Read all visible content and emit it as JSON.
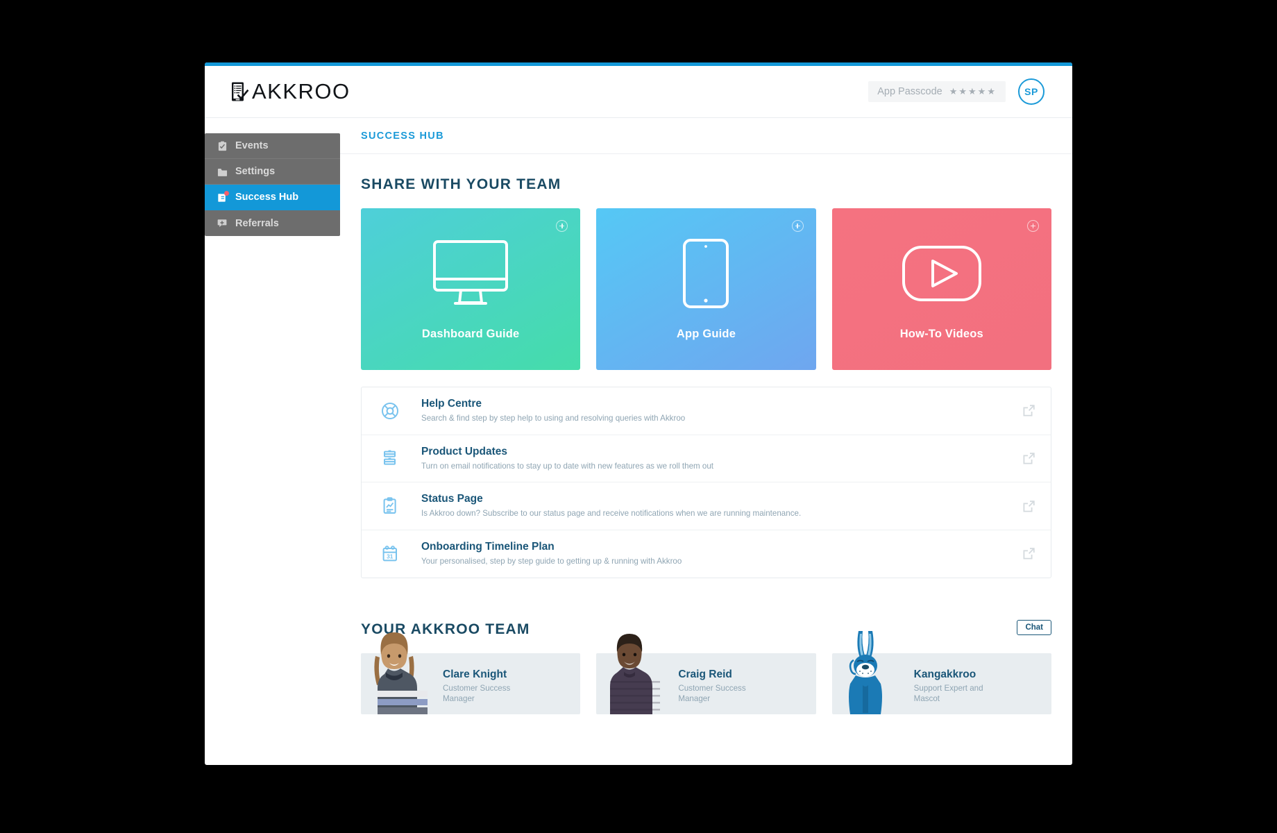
{
  "brand": {
    "name": "AKKROO",
    "logo_icon": "clipboard-check-icon"
  },
  "header": {
    "passcode_label": "App Passcode",
    "passcode_value": "★★★★★",
    "avatar_initials": "SP"
  },
  "sidebar": {
    "items": [
      {
        "label": "Events",
        "icon": "clipboard-icon",
        "active": false,
        "badge": false
      },
      {
        "label": "Settings",
        "icon": "folder-icon",
        "active": false,
        "badge": false
      },
      {
        "label": "Success Hub",
        "icon": "book-badge-icon",
        "active": true,
        "badge": true
      },
      {
        "label": "Referrals",
        "icon": "flag-plus-icon",
        "active": false,
        "badge": false
      }
    ]
  },
  "breadcrumb": {
    "label": "SUCCESS HUB"
  },
  "share_section": {
    "title": "SHARE WITH YOUR TEAM",
    "cards": [
      {
        "label": "Dashboard Guide",
        "art": "desktop-monitor-icon",
        "theme": "teal",
        "action_icon": "plus-circle-icon"
      },
      {
        "label": "App Guide",
        "art": "tablet-icon",
        "theme": "blue",
        "action_icon": "plus-circle-icon"
      },
      {
        "label": "How-To Videos",
        "art": "video-play-icon",
        "theme": "red",
        "action_icon": "plus-circle-icon"
      }
    ]
  },
  "resources": [
    {
      "title": "Help Centre",
      "desc": "Search & find step by step help to using and resolving queries with Akkroo",
      "icon": "lifebuoy-icon",
      "link_icon": "external-link-icon"
    },
    {
      "title": "Product Updates",
      "desc": "Turn on email notifications to stay up to date with new features as we roll them out",
      "icon": "product-updates-icon",
      "link_icon": "external-link-icon"
    },
    {
      "title": "Status Page",
      "desc": "Is Akkroo down? Subscribe to our status page and receive notifications when we are running maintenance.",
      "icon": "clipboard-chart-icon",
      "link_icon": "external-link-icon"
    },
    {
      "title": "Onboarding Timeline Plan",
      "desc": "Your personalised, step by step guide to getting up & running with Akkroo",
      "icon": "calendar-31-icon",
      "link_icon": "external-link-icon"
    }
  ],
  "team_section": {
    "title": "YOUR AKKROO TEAM",
    "chat_label": "Chat",
    "members": [
      {
        "name": "Clare Knight",
        "role": "Customer Success Manager",
        "photo": "photo-clare-knight"
      },
      {
        "name": "Craig Reid",
        "role": "Customer Success Manager",
        "photo": "photo-craig-reid"
      },
      {
        "name": "Kangakkroo",
        "role": "Support Expert and Mascot",
        "photo": "mascot-kangaroo"
      }
    ]
  },
  "colors": {
    "accent_blue": "#1398d8",
    "heading_navy": "#1a4a63",
    "sidebar_grey": "#6d6d6d",
    "badge_red": "#f4606c",
    "card_teal": "#45dcaa",
    "card_blue": "#55c8f5",
    "card_red": "#f57280"
  }
}
